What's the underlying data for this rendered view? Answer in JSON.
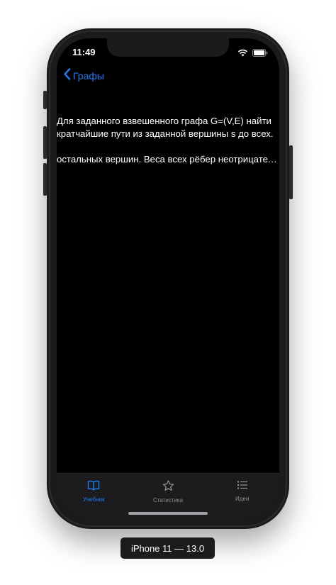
{
  "status_bar": {
    "time": "11:49"
  },
  "nav": {
    "back_label": "Графы"
  },
  "content": {
    "lines": [
      "Для заданного взвешенного графа G=(V,E) найти",
      "кратчайшие пути из заданной вершины s до всех.",
      "остальных вершин. Веса всех рёбер неотрицател..."
    ]
  },
  "tabbar": {
    "items": [
      {
        "label": "Учебник",
        "icon": "book-icon",
        "active": true
      },
      {
        "label": "Статистика",
        "icon": "star-icon",
        "active": false
      },
      {
        "label": "Идеи",
        "icon": "list-icon",
        "active": false
      }
    ]
  },
  "device_caption": "iPhone 11 — 13.0",
  "colors": {
    "accent": "#1e7cf2",
    "background": "#000000",
    "tabbar": "#1c1c1e",
    "inactive": "#8e8e93"
  }
}
